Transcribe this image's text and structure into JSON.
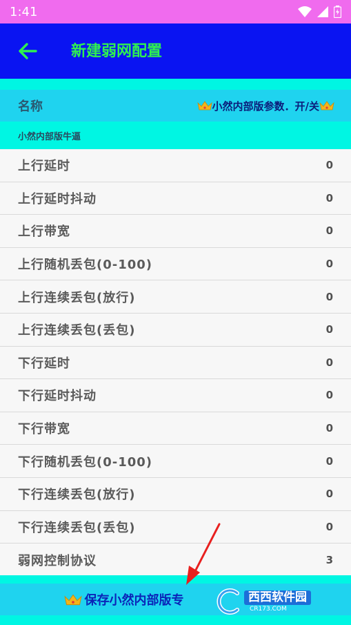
{
  "status_bar": {
    "time": "1:41"
  },
  "toolbar": {
    "title": "新建弱网配置"
  },
  "name_row": {
    "label": "名称",
    "value": "小然内部版参数．开/关"
  },
  "subtitle": "小然内部版牛逼",
  "items": [
    {
      "label": "上行延时",
      "value": "0"
    },
    {
      "label": "上行延时抖动",
      "value": "0"
    },
    {
      "label": "上行带宽",
      "value": "0"
    },
    {
      "label": "上行随机丢包(0-100)",
      "value": "0"
    },
    {
      "label": "上行连续丢包(放行)",
      "value": "0"
    },
    {
      "label": "上行连续丢包(丢包)",
      "value": "0"
    },
    {
      "label": "下行延时",
      "value": "0"
    },
    {
      "label": "下行延时抖动",
      "value": "0"
    },
    {
      "label": "下行带宽",
      "value": "0"
    },
    {
      "label": "下行随机丢包(0-100)",
      "value": "0"
    },
    {
      "label": "下行连续丢包(放行)",
      "value": "0"
    },
    {
      "label": "下行连续丢包(丢包)",
      "value": "0"
    },
    {
      "label": "弱网控制协议",
      "value": "3"
    }
  ],
  "save_button": {
    "label": "保存小然内部版专"
  },
  "watermark": {
    "name": "西西软件园",
    "domain": "CR173.COM"
  },
  "colors": {
    "status_bar": "#f06bee",
    "toolbar": "#0a14f2",
    "title_green": "#2ff050",
    "cyan": "#00f6e3",
    "sky": "#1fd3ef"
  }
}
